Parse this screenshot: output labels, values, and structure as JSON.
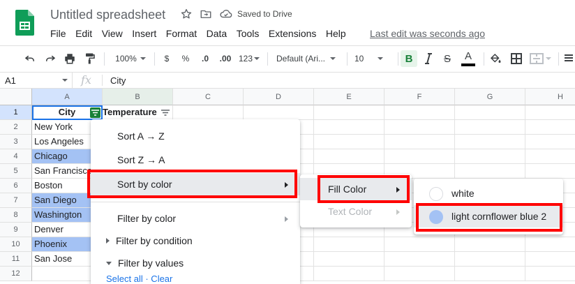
{
  "app": {
    "doc_title": "Untitled spreadsheet",
    "save_status": "Saved to Drive",
    "last_edit": "Last edit was seconds ago"
  },
  "menubar": [
    "File",
    "Edit",
    "View",
    "Insert",
    "Format",
    "Data",
    "Tools",
    "Extensions",
    "Help"
  ],
  "toolbar": {
    "zoom": "100%",
    "currency": "$",
    "percent": "%",
    "dec_decrease": ".0",
    "dec_increase": ".00",
    "more_formats": "123",
    "font": "Default (Ari...",
    "font_size": "10",
    "bold": "B",
    "strike": "S",
    "text_color": "A"
  },
  "formula_bar": {
    "cell_ref": "A1",
    "fx": "fx",
    "value": "City"
  },
  "sheet": {
    "columns": [
      "A",
      "B",
      "C",
      "D",
      "E",
      "F",
      "G",
      "H"
    ],
    "rows": [
      "1",
      "2",
      "3",
      "4",
      "5",
      "6",
      "7",
      "8",
      "9",
      "10",
      "11",
      "12"
    ],
    "header_a": "City",
    "header_b": "Temperature",
    "cities": [
      "New York",
      "Los Angeles",
      "Chicago",
      "San Francisco",
      "Boston",
      "San Diego",
      "Washington",
      "Denver",
      "Phoenix",
      "San Jose"
    ],
    "highlighted_rows": [
      2,
      5,
      6,
      8
    ],
    "highlight_color": "#a4c2f4"
  },
  "filter_menu": {
    "sort_az": "Sort A → Z",
    "sort_za": "Sort Z → A",
    "sort_by_color": "Sort by color",
    "filter_by_color": "Filter by color",
    "filter_by_condition": "Filter by condition",
    "filter_by_values": "Filter by values",
    "select_all_partial": "Select all · Clear"
  },
  "sort_color_menu": {
    "fill_color": "Fill Color",
    "text_color": "Text Color"
  },
  "fill_color_menu": {
    "options": [
      {
        "label": "white",
        "color": "#ffffff"
      },
      {
        "label": "light cornflower blue 2",
        "color": "#a4c2f4"
      }
    ]
  },
  "colors": {
    "accent_green": "#188038",
    "annotation_red": "#ff0000",
    "selection_blue": "#1a73e8"
  }
}
